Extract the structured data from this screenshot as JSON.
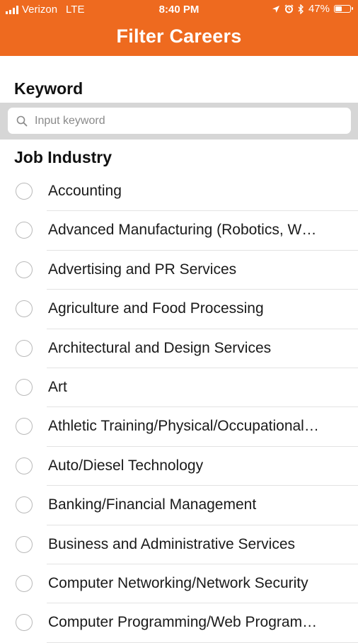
{
  "status_bar": {
    "carrier": "Verizon",
    "network": "LTE",
    "time": "8:40 PM",
    "battery": "47%",
    "battery_level": 0.47,
    "icons": [
      "signal-icon",
      "location-icon",
      "alarm-icon",
      "bluetooth-icon",
      "battery-icon"
    ]
  },
  "header": {
    "title": "Filter Careers",
    "color": "#ee6a1f"
  },
  "keyword": {
    "label": "Keyword",
    "placeholder": "Input keyword",
    "value": ""
  },
  "industry": {
    "label": "Job Industry",
    "items": [
      "Accounting",
      "Advanced Manufacturing (Robotics, W…",
      "Advertising and PR Services",
      "Agriculture and Food Processing",
      "Architectural and Design Services",
      "Art",
      "Athletic Training/Physical/Occupational…",
      "Auto/Diesel Technology",
      "Banking/Financial Management",
      "Business and Administrative Services",
      "Computer Networking/Network Security",
      "Computer Programming/Web Program…"
    ]
  }
}
